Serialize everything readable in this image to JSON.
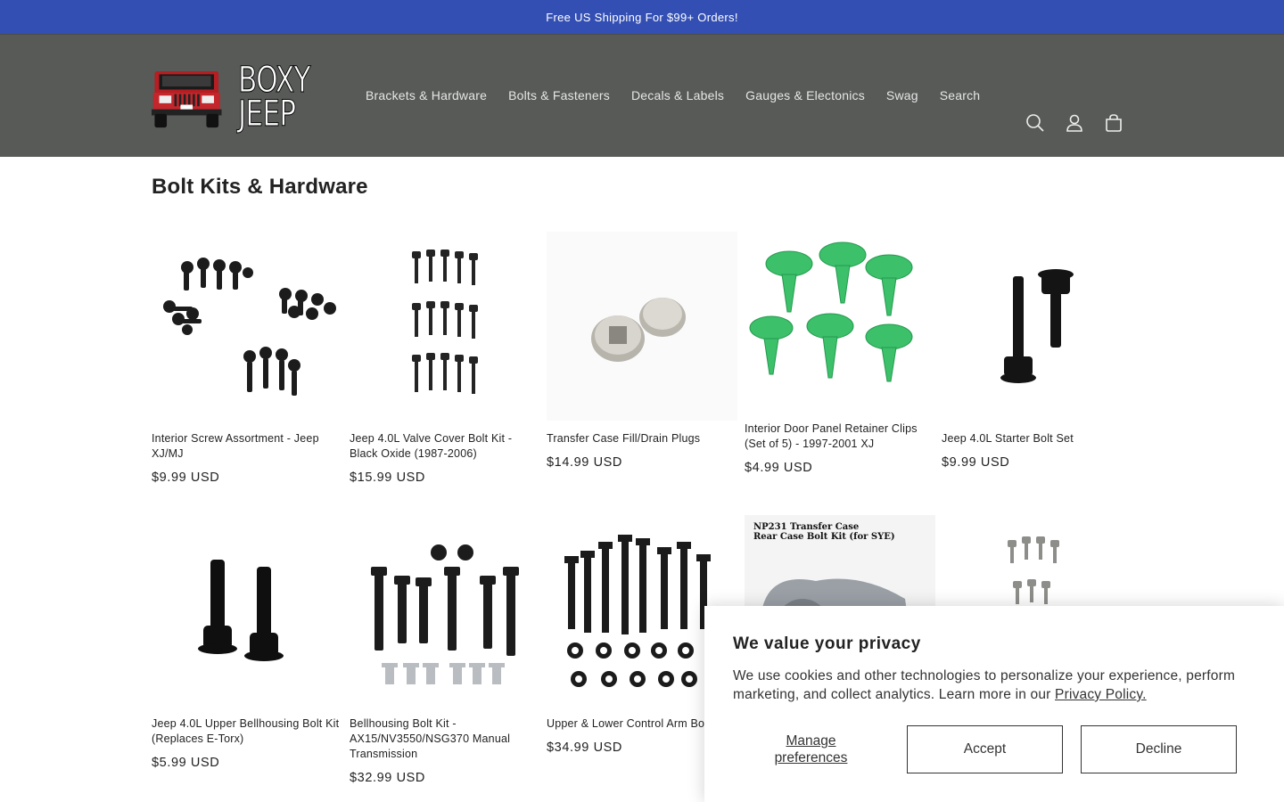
{
  "announcement": "Free US Shipping For $99+ Orders!",
  "logo": {
    "line1": "BOXY",
    "line2": "JEEP"
  },
  "nav": [
    "Brackets & Hardware",
    "Bolts & Fasteners",
    "Decals & Labels",
    "Gauges & Electonics",
    "Swag",
    "Search"
  ],
  "page_title": "Bolt Kits & Hardware",
  "products": [
    {
      "name": "Interior Screw Assortment - Jeep XJ/MJ",
      "price": "$9.99 USD"
    },
    {
      "name": "Jeep 4.0L Valve Cover Bolt Kit - Black Oxide (1987-2006)",
      "price": "$15.99 USD"
    },
    {
      "name": "Transfer Case Fill/Drain Plugs",
      "price": "$14.99 USD"
    },
    {
      "name": "Interior Door Panel Retainer Clips (Set of 5) - 1997-2001 XJ",
      "price": "$4.99 USD"
    },
    {
      "name": "Jeep 4.0L Starter Bolt Set",
      "price": "$9.99 USD"
    },
    {
      "name": "Jeep 4.0L Upper Bellhousing Bolt Kit (Replaces E-Torx)",
      "price": "$5.99 USD"
    },
    {
      "name": "Bellhousing Bolt Kit - AX15/NV3550/NSG370 Manual Transmission",
      "price": "$32.99 USD"
    },
    {
      "name": "Upper & Lower Control Arm Bo",
      "price": "$34.99 USD"
    }
  ],
  "np231_label": {
    "line1": "NP231 Transfer Case",
    "line2": "Rear Case Bolt Kit (for SYE)"
  },
  "privacy": {
    "title": "We value your privacy",
    "body": "We use cookies and other technologies to personalize your experience, perform marketing, and collect analytics. Learn more in our ",
    "link": "Privacy Policy.",
    "manage_line1": "Manage",
    "manage_line2": "preferences",
    "accept": "Accept",
    "decline": "Decline"
  },
  "colors": {
    "announcement_bg": "#334fb4",
    "header_bg": "#575a57",
    "clip_green": "#3cc06a"
  }
}
